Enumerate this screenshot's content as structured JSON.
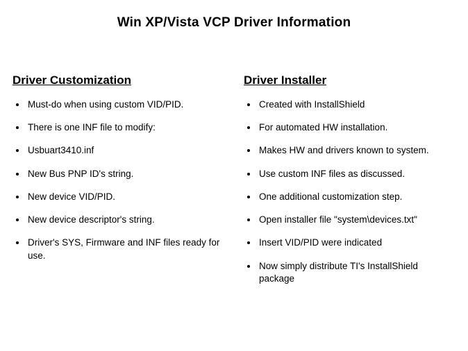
{
  "title": "Win XP/Vista VCP Driver Information",
  "columns": [
    {
      "heading": "Driver Customization",
      "items": [
        "Must-do when using custom VID/PID.",
        "There is one INF file to modify:",
        "Usbuart3410.inf",
        "New Bus PNP ID's string.",
        "New device VID/PID.",
        "New device descriptor's string.",
        "Driver's SYS, Firmware and INF files ready for use."
      ]
    },
    {
      "heading": "Driver Installer",
      "items": [
        "Created with InstallShield",
        "For automated HW installation.",
        "Makes HW and drivers known to system.",
        "Use custom INF files as discussed.",
        "One additional customization step.",
        "Open installer file \"system\\devices.txt\"",
        "Insert VID/PID were indicated",
        "Now simply distribute TI's InstallShield package"
      ]
    }
  ]
}
